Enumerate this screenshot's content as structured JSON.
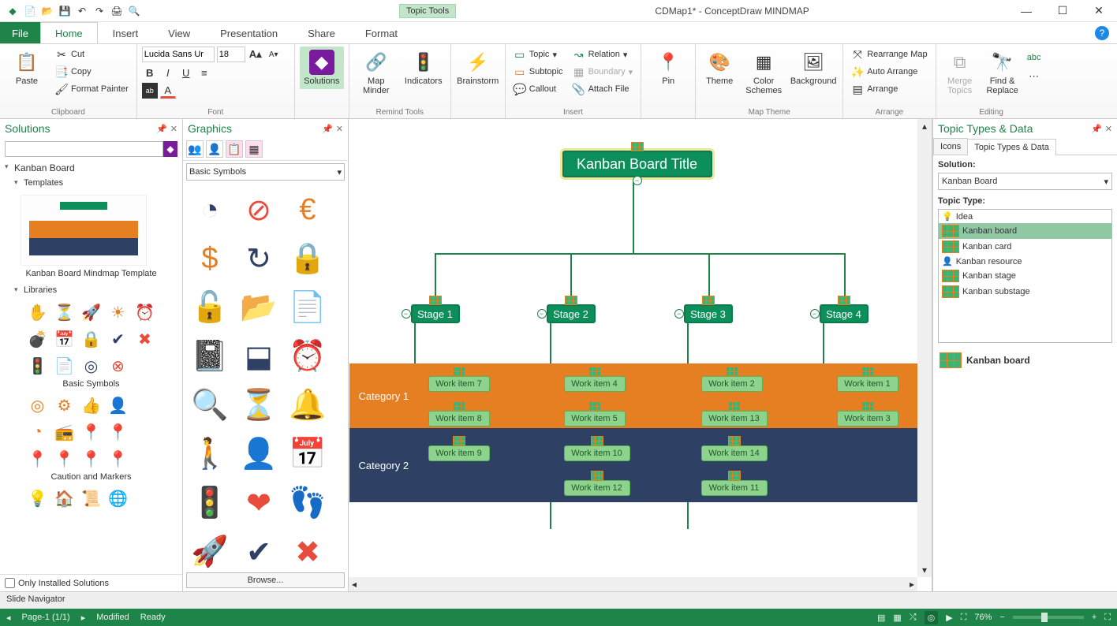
{
  "titlebar": {
    "contextual": "Topic Tools",
    "title": "CDMap1* - ConceptDraw MINDMAP"
  },
  "tabs": {
    "file": "File",
    "items": [
      "Home",
      "Insert",
      "View",
      "Presentation",
      "Share",
      "Format"
    ],
    "active": "Home"
  },
  "ribbon": {
    "clipboard": {
      "paste": "Paste",
      "cut": "Cut",
      "copy": "Copy",
      "fmt": "Format Painter",
      "label": "Clipboard"
    },
    "font": {
      "name": "Lucida Sans Ur",
      "size": "18",
      "label": "Font"
    },
    "solutions": "Solutions",
    "remind": {
      "map": "Map Minder",
      "ind": "Indicators",
      "label": "Remind Tools"
    },
    "brain": "Brainstorm",
    "insert": {
      "topic": "Topic",
      "subtopic": "Subtopic",
      "callout": "Callout",
      "relation": "Relation",
      "boundary": "Boundary",
      "attach": "Attach File",
      "label": "Insert"
    },
    "pin": "Pin",
    "theme": {
      "theme": "Theme",
      "color": "Color Schemes",
      "bg": "Background",
      "label": "Map Theme"
    },
    "arrange": {
      "re": "Rearrange Map",
      "auto": "Auto Arrange",
      "arr": "Arrange",
      "label": "Arrange"
    },
    "edit": {
      "merge": "Merge Topics",
      "find": "Find & Replace",
      "label": "Editing"
    }
  },
  "solutions_panel": {
    "title": "Solutions",
    "kanban": "Kanban Board",
    "templates": "Templates",
    "thumb": "Kanban Board Mindmap Template",
    "libraries": "Libraries",
    "lib1": "Basic Symbols",
    "lib2": "Caution and Markers",
    "only": "Only Installed Solutions"
  },
  "graphics_panel": {
    "title": "Graphics",
    "select": "Basic Symbols",
    "browse": "Browse...",
    "symbols": [
      {
        "g": "◔",
        "c": "#2e4063"
      },
      {
        "g": "⊘",
        "c": "#e74c3c"
      },
      {
        "g": "€",
        "c": "#e67e22"
      },
      {
        "g": "$",
        "c": "#e67e22"
      },
      {
        "g": "↻",
        "c": "#2e4063"
      },
      {
        "g": "🔒",
        "c": "#e67e22"
      },
      {
        "g": "🔓",
        "c": "#e67e22"
      },
      {
        "g": "📂",
        "c": "#2e4063"
      },
      {
        "g": "📄",
        "c": "#2e4063"
      },
      {
        "g": "📓",
        "c": "#2e4063"
      },
      {
        "g": "⬓",
        "c": "#2e4063"
      },
      {
        "g": "⏰",
        "c": "#e67e22"
      },
      {
        "g": "🔍",
        "c": "#2e4063"
      },
      {
        "g": "⏳",
        "c": "#e67e22"
      },
      {
        "g": "🔔",
        "c": "#2e4063"
      },
      {
        "g": "🚶",
        "c": "#2e4063"
      },
      {
        "g": "👤",
        "c": "#2e4063"
      },
      {
        "g": "📅",
        "c": "#2e4063"
      },
      {
        "g": "🚦",
        "c": "#2e4063"
      },
      {
        "g": "❤",
        "c": "#e74c3c"
      },
      {
        "g": "👣",
        "c": "#2e4063"
      },
      {
        "g": "🚀",
        "c": "#2e4063"
      },
      {
        "g": "✔",
        "c": "#2e4063"
      },
      {
        "g": "✖",
        "c": "#e74c3c"
      },
      {
        "g": "✋",
        "c": "#e74c3c"
      },
      {
        "g": "☢",
        "c": "#e67e22"
      },
      {
        "g": "💣",
        "c": "#2e4063"
      }
    ]
  },
  "mindmap": {
    "title": "Kanban Board Title",
    "stages": [
      "Stage 1",
      "Stage 2",
      "Stage 3",
      "Stage 4"
    ],
    "cat1": "Category 1",
    "cat2": "Category 2",
    "work": {
      "s1": [
        "Work item 7",
        "Work item 8",
        "Work item 9"
      ],
      "s2": [
        "Work item 4",
        "Work item 5",
        "Work item 10",
        "Work item 12"
      ],
      "s3": [
        "Work item 2",
        "Work item 13",
        "Work item 14",
        "Work item 11"
      ],
      "s4": [
        "Work item 1",
        "Work item 3"
      ]
    }
  },
  "right_panel": {
    "title": "Topic Types & Data",
    "tabs": {
      "icons": "Icons",
      "ttd": "Topic Types & Data"
    },
    "solution_label": "Solution:",
    "solution_value": "Kanban Board",
    "tt_label": "Topic Type:",
    "types": [
      "Idea",
      "Kanban board",
      "Kanban card",
      "Kanban resource",
      "Kanban stage",
      "Kanban substage"
    ],
    "selected": "Kanban board",
    "bottom": "Kanban board"
  },
  "slide_nav": "Slide Navigator",
  "status": {
    "page": "Page-1 (1/1)",
    "mod": "Modified",
    "ready": "Ready",
    "zoom": "76%"
  }
}
